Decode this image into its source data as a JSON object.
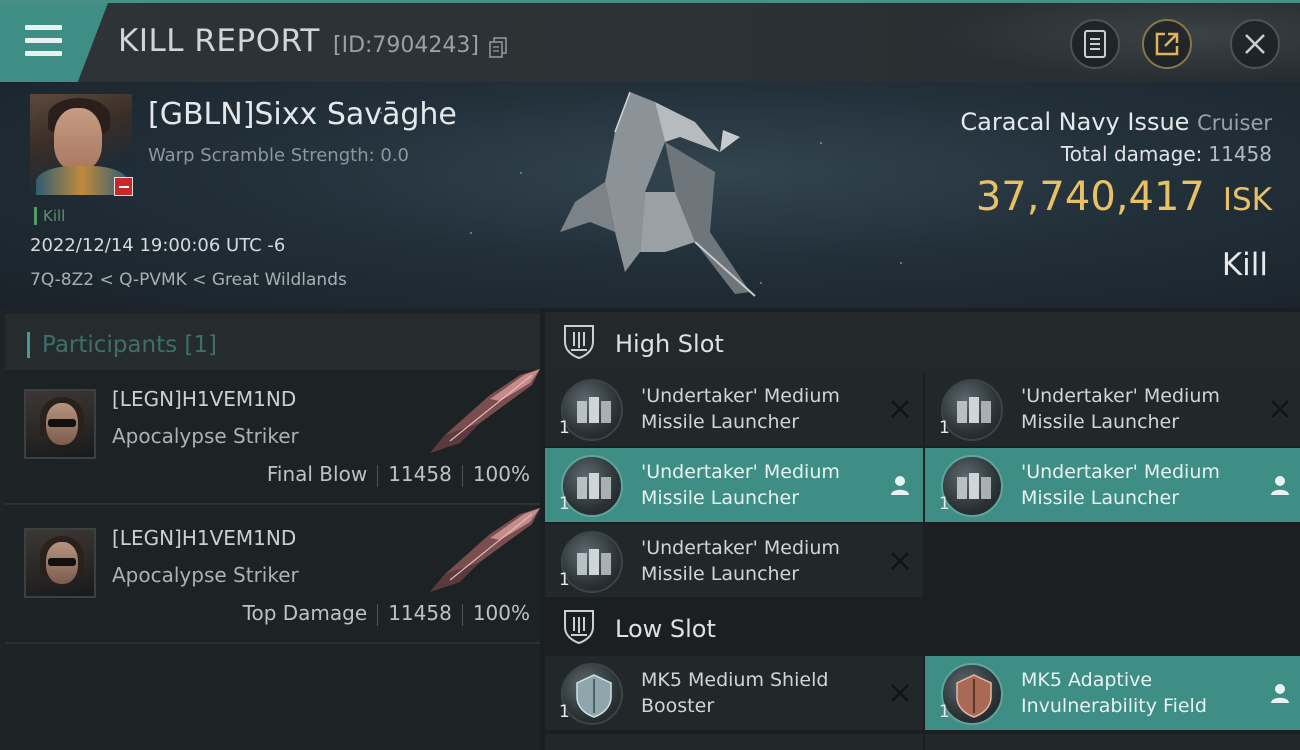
{
  "header": {
    "title": "KILL REPORT",
    "id_label": "[ID:7904243]",
    "icons": [
      "menu-icon",
      "copy-icon",
      "clipboard-icon",
      "share-icon",
      "close-icon"
    ],
    "accent_color": "#3f8e85"
  },
  "victim": {
    "name": "[GBLN]Sixx Savāghe",
    "warp_scramble": "Warp Scramble Strength: 0.0",
    "kill_tag": "Kill",
    "datetime": "2022/12/14 19:00:06 UTC -6",
    "location": "7Q-8Z2 < Q-PVMK < Great Wildlands",
    "ship_name": "Caracal Navy Issue",
    "ship_class": "Cruiser",
    "total_damage_label": "Total damage:",
    "total_damage": "11458",
    "isk_value": "37,740,417",
    "isk_unit": "ISK",
    "kill_type": "Kill"
  },
  "participants": {
    "label": "Participants",
    "count": "[1]",
    "rows": [
      {
        "name": "[LEGN]H1VEM1ND",
        "ship": "Apocalypse Striker",
        "tag": "Final Blow",
        "damage": "11458",
        "percent": "100%"
      },
      {
        "name": "[LEGN]H1VEM1ND",
        "ship": "Apocalypse Striker",
        "tag": "Top Damage",
        "damage": "11458",
        "percent": "100%"
      }
    ]
  },
  "slots": {
    "high": {
      "label": "High Slot",
      "modules": [
        {
          "name_line1": "'Undertaker' Medium",
          "name_line2": "Missile Launcher",
          "qty": "1",
          "status": "destroyed"
        },
        {
          "name_line1": "'Undertaker' Medium",
          "name_line2": "Missile Launcher",
          "qty": "1",
          "status": "destroyed"
        },
        {
          "name_line1": "'Undertaker' Medium",
          "name_line2": "Missile Launcher",
          "qty": "1",
          "status": "dropped"
        },
        {
          "name_line1": "'Undertaker' Medium",
          "name_line2": "Missile Launcher",
          "qty": "1",
          "status": "dropped"
        },
        {
          "name_line1": "'Undertaker' Medium",
          "name_line2": "Missile Launcher",
          "qty": "1",
          "status": "destroyed"
        }
      ]
    },
    "low": {
      "label": "Low Slot",
      "modules": [
        {
          "name_line1": "MK5 Medium Shield",
          "name_line2": "Booster",
          "qty": "1",
          "status": "destroyed"
        },
        {
          "name_line1": "MK5 Adaptive",
          "name_line2": "Invulnerability Field",
          "qty": "1",
          "status": "dropped"
        }
      ]
    }
  },
  "colors": {
    "isk": "#e8c165",
    "dropped": "#3f8e85",
    "destroyed_mark": "#111417"
  }
}
